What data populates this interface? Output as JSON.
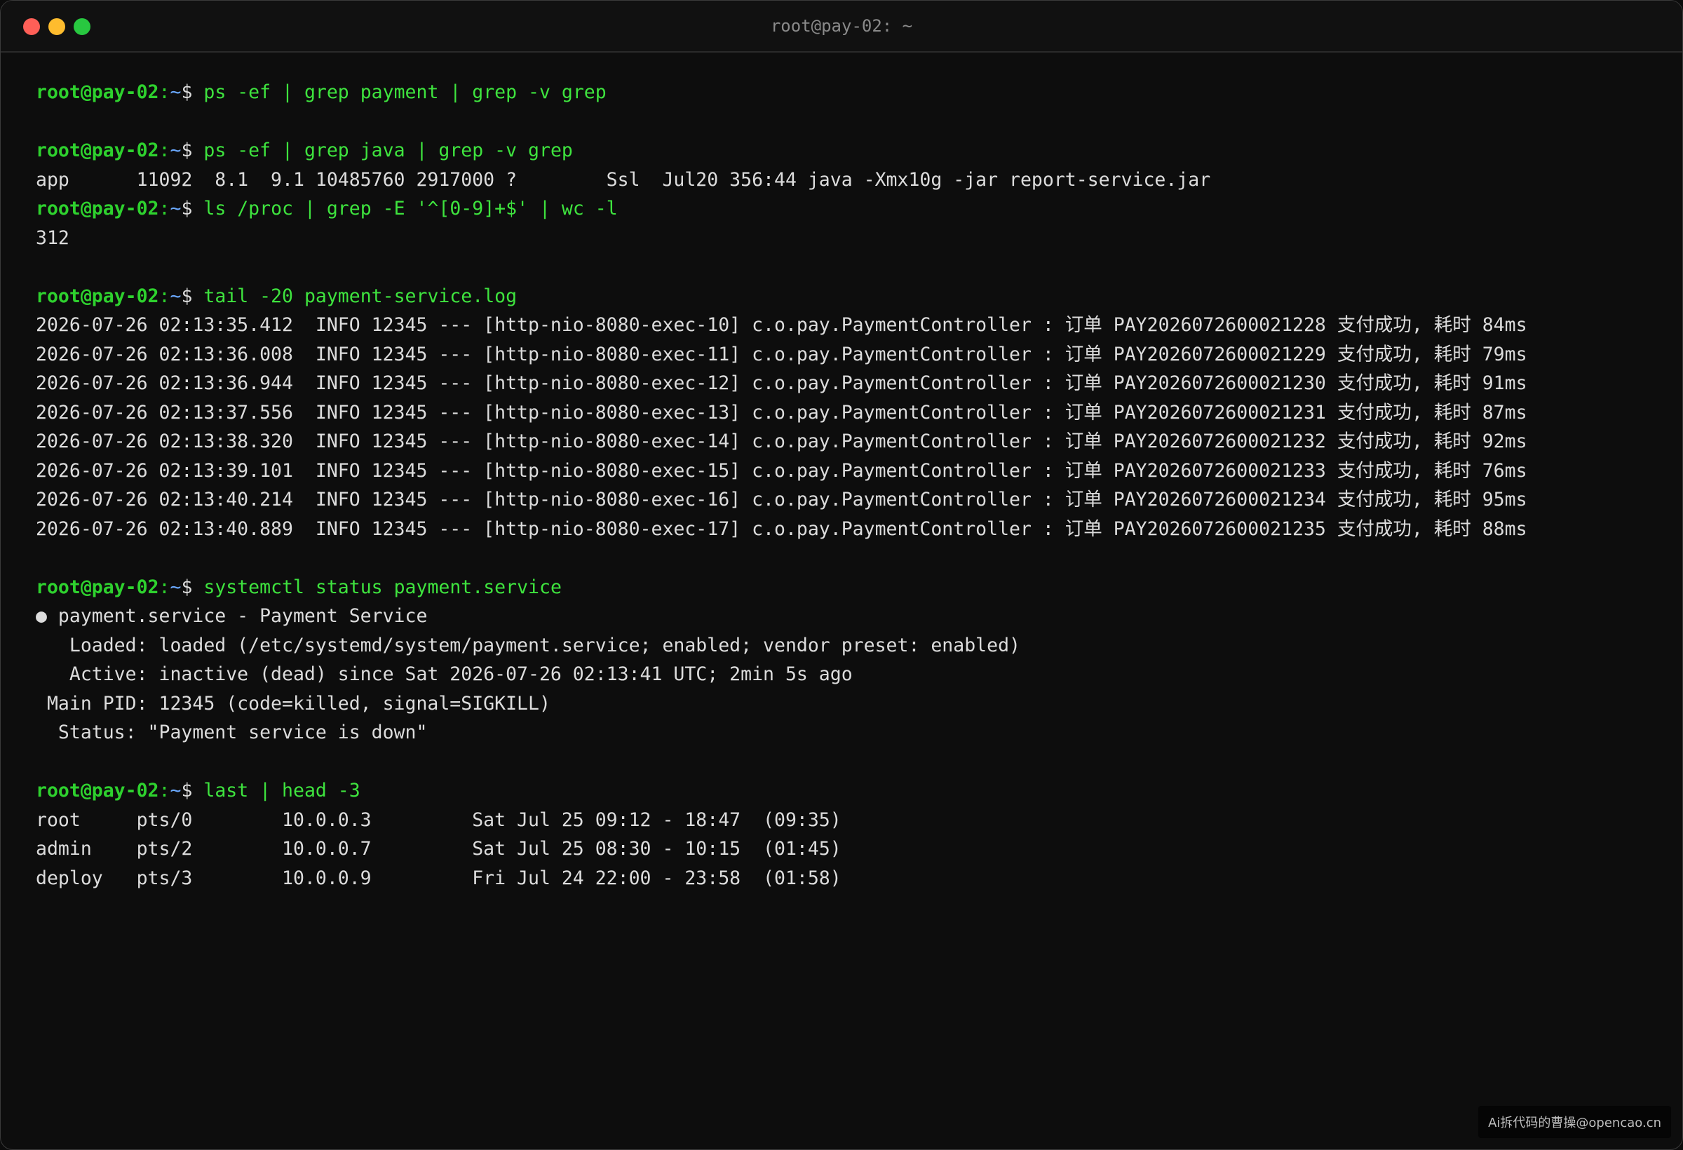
{
  "window": {
    "title": "root@pay-02: ~"
  },
  "prompt": {
    "user_host": "root@pay-02",
    "sep": ":",
    "path": "~",
    "dollar": "$ "
  },
  "lines": [
    {
      "type": "cmd",
      "cmd": "ps -ef | grep payment | grep -v grep"
    },
    {
      "type": "blank"
    },
    {
      "type": "cmd",
      "cmd": "ps -ef | grep java | grep -v grep"
    },
    {
      "type": "out",
      "text": "app      11092  8.1  9.1 10485760 2917000 ?        Ssl  Jul20 356:44 java -Xmx10g -jar report-service.jar"
    },
    {
      "type": "cmd",
      "cmd": "ls /proc | grep -E '^[0-9]+$' | wc -l"
    },
    {
      "type": "out",
      "text": "312"
    },
    {
      "type": "blank"
    },
    {
      "type": "cmd",
      "cmd": "tail -20 payment-service.log"
    },
    {
      "type": "out",
      "text": "2026-07-26 02:13:35.412  INFO 12345 --- [http-nio-8080-exec-10] c.o.pay.PaymentController : 订单 PAY2026072600021228 支付成功, 耗时 84ms"
    },
    {
      "type": "out",
      "text": "2026-07-26 02:13:36.008  INFO 12345 --- [http-nio-8080-exec-11] c.o.pay.PaymentController : 订单 PAY2026072600021229 支付成功, 耗时 79ms"
    },
    {
      "type": "out",
      "text": "2026-07-26 02:13:36.944  INFO 12345 --- [http-nio-8080-exec-12] c.o.pay.PaymentController : 订单 PAY2026072600021230 支付成功, 耗时 91ms"
    },
    {
      "type": "out",
      "text": "2026-07-26 02:13:37.556  INFO 12345 --- [http-nio-8080-exec-13] c.o.pay.PaymentController : 订单 PAY2026072600021231 支付成功, 耗时 87ms"
    },
    {
      "type": "out",
      "text": "2026-07-26 02:13:38.320  INFO 12345 --- [http-nio-8080-exec-14] c.o.pay.PaymentController : 订单 PAY2026072600021232 支付成功, 耗时 92ms"
    },
    {
      "type": "out",
      "text": "2026-07-26 02:13:39.101  INFO 12345 --- [http-nio-8080-exec-15] c.o.pay.PaymentController : 订单 PAY2026072600021233 支付成功, 耗时 76ms"
    },
    {
      "type": "out",
      "text": "2026-07-26 02:13:40.214  INFO 12345 --- [http-nio-8080-exec-16] c.o.pay.PaymentController : 订单 PAY2026072600021234 支付成功, 耗时 95ms"
    },
    {
      "type": "out",
      "text": "2026-07-26 02:13:40.889  INFO 12345 --- [http-nio-8080-exec-17] c.o.pay.PaymentController : 订单 PAY2026072600021235 支付成功, 耗时 88ms"
    },
    {
      "type": "blank"
    },
    {
      "type": "cmd",
      "cmd": "systemctl status payment.service"
    },
    {
      "type": "out",
      "text": "● payment.service - Payment Service"
    },
    {
      "type": "out",
      "text": "   Loaded: loaded (/etc/systemd/system/payment.service; enabled; vendor preset: enabled)"
    },
    {
      "type": "out",
      "text": "   Active: inactive (dead) since Sat 2026-07-26 02:13:41 UTC; 2min 5s ago"
    },
    {
      "type": "out",
      "text": " Main PID: 12345 (code=killed, signal=SIGKILL)"
    },
    {
      "type": "out",
      "text": "  Status: \"Payment service is down\""
    },
    {
      "type": "blank"
    },
    {
      "type": "cmd",
      "cmd": "last | head -3"
    },
    {
      "type": "out",
      "text": "root     pts/0        10.0.0.3         Sat Jul 25 09:12 - 18:47  (09:35)"
    },
    {
      "type": "out",
      "text": "admin    pts/2        10.0.0.7         Sat Jul 25 08:30 - 10:15  (01:45)"
    },
    {
      "type": "out",
      "text": "deploy   pts/3        10.0.0.9         Fri Jul 24 22:00 - 23:58  (01:58)"
    }
  ],
  "watermark": "Ai拆代码的曹操@opencao.cn"
}
